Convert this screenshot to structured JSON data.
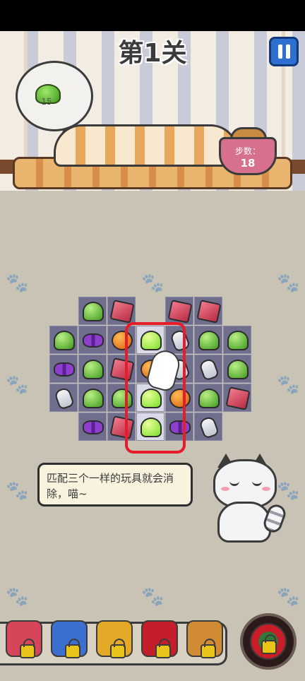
{
  "header": {
    "level_title": "第1关",
    "pause_icon": "pause-icon"
  },
  "goal": {
    "target_icon": "green-jelly-icon",
    "count": "15"
  },
  "moves": {
    "label": "步数：",
    "value": "18"
  },
  "hint": {
    "text": "匹配三个一样的玩具就会消除，喵~"
  },
  "board": {
    "rows": [
      [
        "",
        "jelly",
        "cube",
        "",
        "cube",
        "cube",
        ""
      ],
      [
        "jelly",
        "bow",
        "ball",
        "jelly-bright",
        "bottle",
        "jelly",
        "jelly"
      ],
      [
        "bow",
        "jelly",
        "cube",
        "ball",
        "bottle",
        "bottle",
        "jelly"
      ],
      [
        "bottle",
        "jelly",
        "jelly",
        "jelly-bright",
        "ball",
        "jelly",
        "cube"
      ],
      [
        "",
        "bow",
        "cube",
        "jelly-bright",
        "bow",
        "bottle",
        ""
      ]
    ]
  },
  "boosters": [
    {
      "name": "boxing-glove-booster",
      "locked": true
    },
    {
      "name": "toy-truck-booster",
      "locked": true
    },
    {
      "name": "paint-bucket-booster",
      "locked": true
    },
    {
      "name": "bomb-ball-booster",
      "locked": true
    },
    {
      "name": "cookie-booster",
      "locked": true
    },
    {
      "name": "yarn-ball-booster",
      "locked": true
    }
  ],
  "colors": {
    "highlight": "#e61c2a",
    "pause_button": "#2f6fcf",
    "bowl": "#d7708c"
  }
}
